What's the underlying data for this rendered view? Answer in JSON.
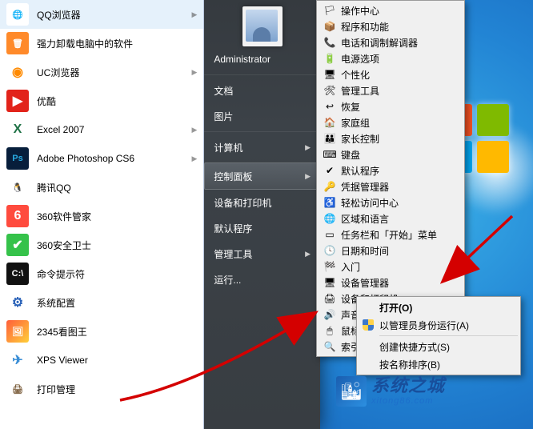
{
  "start_menu": {
    "apps": [
      {
        "label": "QQ浏览器",
        "icon": "🌐",
        "icon_bg": "#fff",
        "icon_color": "#29a7e1",
        "arrow": true
      },
      {
        "label": "强力卸载电脑中的软件",
        "icon": "🗑",
        "icon_bg": "#ff8a2a",
        "icon_color": "#fff",
        "arrow": false
      },
      {
        "label": "UC浏览器",
        "icon": "◉",
        "icon_bg": "#fff",
        "icon_color": "#ff8a00",
        "arrow": true
      },
      {
        "label": "优酷",
        "icon": "▶",
        "icon_bg": "#e2231a",
        "icon_color": "#fff",
        "arrow": false
      },
      {
        "label": "Excel 2007",
        "icon": "X",
        "icon_bg": "#fff",
        "icon_color": "#1f7246",
        "arrow": true
      },
      {
        "label": "Adobe Photoshop CS6",
        "icon": "Ps",
        "icon_bg": "#071e3b",
        "icon_color": "#29abe2",
        "arrow": true
      },
      {
        "label": "腾讯QQ",
        "icon": "🐧",
        "icon_bg": "#fff",
        "icon_color": "#000",
        "arrow": false
      },
      {
        "label": "360软件管家",
        "icon": "6",
        "icon_bg": "#ff4b3e",
        "icon_color": "#fff",
        "arrow": false
      },
      {
        "label": "360安全卫士",
        "icon": "✔",
        "icon_bg": "#35c24a",
        "icon_color": "#fff",
        "arrow": false
      },
      {
        "label": "命令提示符",
        "icon": "C:\\",
        "icon_bg": "#111",
        "icon_color": "#fff",
        "arrow": false
      },
      {
        "label": "系统配置",
        "icon": "⚙",
        "icon_bg": "#fff",
        "icon_color": "#2a62b8",
        "arrow": false
      },
      {
        "label": "2345看图王",
        "icon": "🖼",
        "icon_bg": "linear-gradient(135deg,#ff5e3a,#ffcf3a)",
        "icon_color": "#fff",
        "arrow": false
      },
      {
        "label": "XPS Viewer",
        "icon": "✈",
        "icon_bg": "#fff",
        "icon_color": "#3a8ed6",
        "arrow": false
      },
      {
        "label": "打印管理",
        "icon": "🖨",
        "icon_bg": "#fff",
        "icon_color": "#7a5c3a",
        "arrow": false
      }
    ],
    "right": [
      {
        "label": "Administrator",
        "arrow": false
      },
      {
        "label": "文档",
        "arrow": false,
        "sep": true
      },
      {
        "label": "图片",
        "arrow": false
      },
      {
        "label": "计算机",
        "arrow": true,
        "sep": true
      },
      {
        "label": "控制面板",
        "arrow": true,
        "highlight": true,
        "sep": true
      },
      {
        "label": "设备和打印机",
        "arrow": false
      },
      {
        "label": "默认程序",
        "arrow": false
      },
      {
        "label": "管理工具",
        "arrow": true
      },
      {
        "label": "运行...",
        "arrow": false
      }
    ]
  },
  "control_panel_submenu": [
    {
      "label": "操作中心",
      "icon": "🏳"
    },
    {
      "label": "程序和功能",
      "icon": "📦"
    },
    {
      "label": "电话和调制解调器",
      "icon": "📞"
    },
    {
      "label": "电源选项",
      "icon": "🔋"
    },
    {
      "label": "个性化",
      "icon": "🖥"
    },
    {
      "label": "管理工具",
      "icon": "🛠"
    },
    {
      "label": "恢复",
      "icon": "↩"
    },
    {
      "label": "家庭组",
      "icon": "🏠"
    },
    {
      "label": "家长控制",
      "icon": "👪"
    },
    {
      "label": "键盘",
      "icon": "⌨"
    },
    {
      "label": "默认程序",
      "icon": "✔"
    },
    {
      "label": "凭据管理器",
      "icon": "🔑"
    },
    {
      "label": "轻松访问中心",
      "icon": "♿"
    },
    {
      "label": "区域和语言",
      "icon": "🌐"
    },
    {
      "label": "任务栏和「开始」菜单",
      "icon": "▭"
    },
    {
      "label": "日期和时间",
      "icon": "🕓"
    },
    {
      "label": "入门",
      "icon": "🏁"
    },
    {
      "label": "设备管理器",
      "icon": "🖥"
    },
    {
      "label": "设备和打印机",
      "icon": "🖨"
    },
    {
      "label": "声音",
      "icon": "🔊"
    },
    {
      "label": "鼠标",
      "icon": "🖱"
    },
    {
      "label": "索引选项",
      "icon": "🔍"
    }
  ],
  "context_menu": {
    "items": [
      {
        "label": "打开(O)",
        "default": true
      },
      {
        "label": "以管理员身份运行(A)",
        "shield": true
      },
      {
        "sep": true
      },
      {
        "label": "创建快捷方式(S)"
      },
      {
        "label": "按名称排序(B)"
      }
    ]
  },
  "watermark": {
    "cn": "系统之城",
    "en": "xitong86.com"
  },
  "accent_red": "#d40000"
}
